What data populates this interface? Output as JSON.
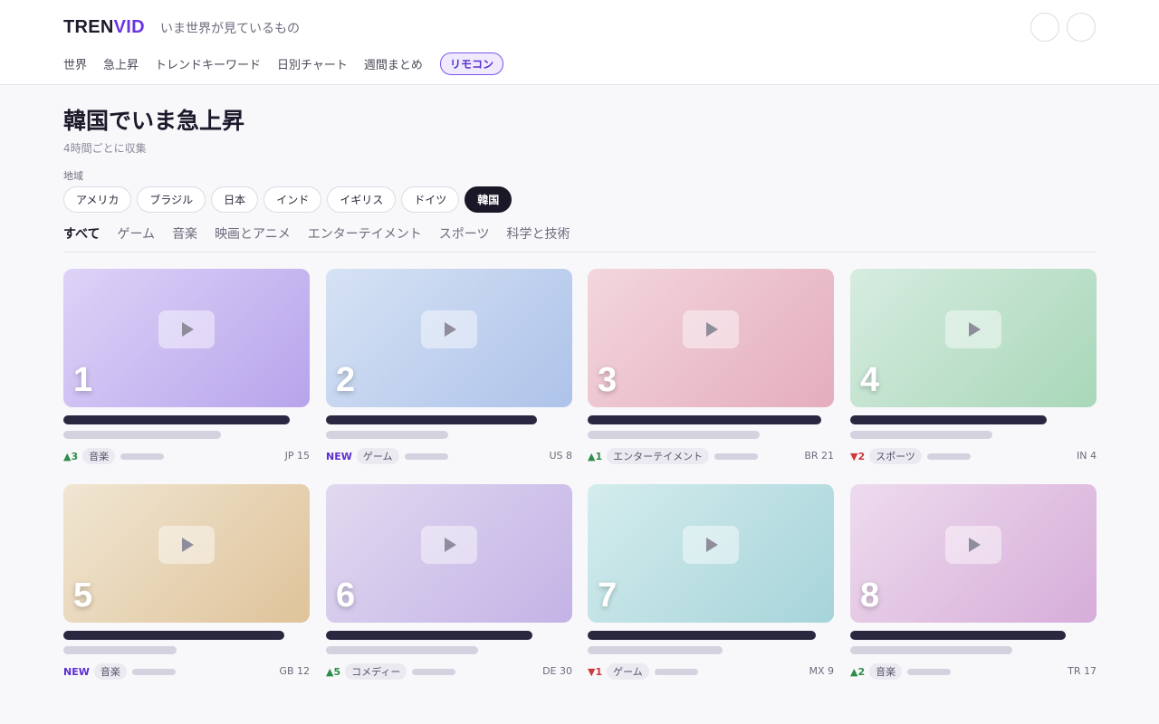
{
  "header": {
    "logo_primary": "TREN",
    "logo_accent": "VID",
    "tagline": "いま世界が見ているもの",
    "nav": [
      "世界",
      "急上昇",
      "トレンドキーワード",
      "日別チャート",
      "週間まとめ"
    ],
    "remote_label": "リモコン",
    "accent_color": "#6a35e0"
  },
  "page": {
    "title": "韓国でいま急上昇",
    "subtitle": "4時間ごとに収集",
    "region_label": "地域",
    "regions": [
      "アメリカ",
      "ブラジル",
      "日本",
      "インド",
      "イギリス",
      "ドイツ",
      "韓国"
    ],
    "active_region": "韓国",
    "categories": [
      "すべて",
      "ゲーム",
      "音楽",
      "映画とアニメ",
      "エンターテイメント",
      "スポーツ",
      "科学と技術"
    ],
    "active_category": "すべて"
  },
  "cards": [
    {
      "rank": "1",
      "change": "▲3",
      "change_type": "up",
      "category": "音楽",
      "region": "JP 15",
      "gradient": [
        "#ddd3f7",
        "#b7a4ec"
      ]
    },
    {
      "rank": "2",
      "change": "NEW",
      "change_type": "new",
      "category": "ゲーム",
      "region": "US 8",
      "gradient": [
        "#d6e2f4",
        "#aec3ea"
      ]
    },
    {
      "rank": "3",
      "change": "▲1",
      "change_type": "up",
      "category": "エンターテイメント",
      "region": "BR 21",
      "gradient": [
        "#f3d6de",
        "#e4adbd"
      ]
    },
    {
      "rank": "4",
      "change": "▼2",
      "change_type": "down",
      "category": "スポーツ",
      "region": "IN 4",
      "gradient": [
        "#d6ece0",
        "#a9d7b9"
      ]
    },
    {
      "rank": "5",
      "change": "NEW",
      "change_type": "new",
      "category": "音楽",
      "region": "GB 12",
      "gradient": [
        "#f0e6d2",
        "#dfc39a"
      ]
    },
    {
      "rank": "6",
      "change": "▲5",
      "change_type": "up",
      "category": "コメディー",
      "region": "DE 30",
      "gradient": [
        "#e1d9f0",
        "#c4b3e6"
      ]
    },
    {
      "rank": "7",
      "change": "▼1",
      "change_type": "down",
      "category": "ゲーム",
      "region": "MX 9",
      "gradient": [
        "#d4eced",
        "#a6d4da"
      ]
    },
    {
      "rank": "8",
      "change": "▲2",
      "change_type": "up",
      "category": "音楽",
      "region": "TR 17",
      "gradient": [
        "#eedbee",
        "#d6add9"
      ]
    }
  ]
}
